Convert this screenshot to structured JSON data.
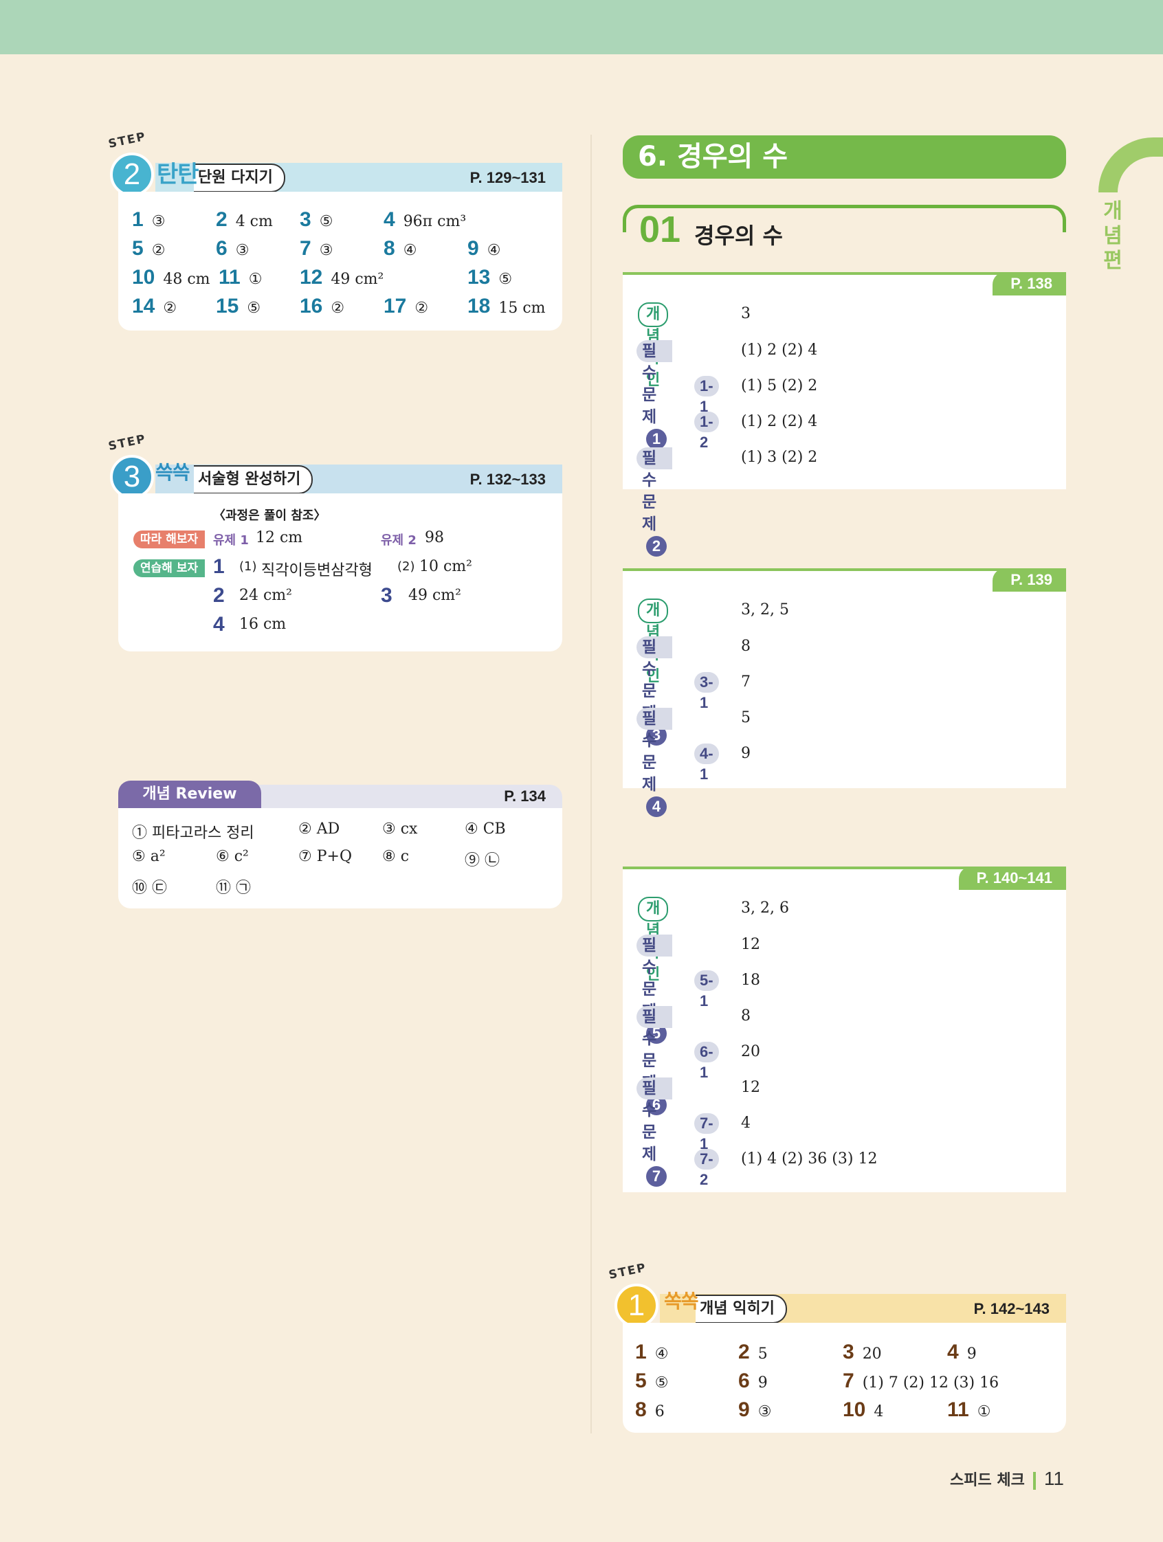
{
  "step2": {
    "step_label": "STEP",
    "step_num": "2",
    "title_big": "탄탄",
    "title": "단원 다지기",
    "pages": "P. 129~131",
    "answers": [
      {
        "n": "1",
        "v": "③"
      },
      {
        "n": "2",
        "v": "4 cm"
      },
      {
        "n": "3",
        "v": "⑤"
      },
      {
        "n": "4",
        "v": "96π cm³"
      },
      {
        "n": "5",
        "v": "②"
      },
      {
        "n": "6",
        "v": "③"
      },
      {
        "n": "7",
        "v": "③"
      },
      {
        "n": "8",
        "v": "④"
      },
      {
        "n": "9",
        "v": "④"
      },
      {
        "n": "10",
        "v": "48 cm"
      },
      {
        "n": "11",
        "v": "①"
      },
      {
        "n": "12",
        "v": "49 cm²"
      },
      {
        "n": "13",
        "v": "⑤"
      },
      {
        "n": "14",
        "v": "②"
      },
      {
        "n": "15",
        "v": "⑤"
      },
      {
        "n": "16",
        "v": "②"
      },
      {
        "n": "17",
        "v": "②"
      },
      {
        "n": "18",
        "v": "15 cm"
      }
    ]
  },
  "step3": {
    "step_label": "STEP",
    "step_num": "3",
    "title_big": "쓱쓱",
    "title": "서술형 완성하기",
    "pages": "P. 132~133",
    "note": "〈과정은 풀이 참조〉",
    "tag1": "따라 해보자",
    "tag2": "연습해 보자",
    "ex1_label": "유제 1",
    "ex1_value": "12 cm",
    "ex2_label": "유제 2",
    "ex2_value": "98",
    "p1_num": "1",
    "p1_a_label": "(1)",
    "p1_a": "직각이등변삼각형",
    "p1_b_label": "(2)",
    "p1_b": "10 cm²",
    "p2_num": "2",
    "p2": "24 cm²",
    "p3_num": "3",
    "p3": "49 cm²",
    "p4_num": "4",
    "p4": "16 cm"
  },
  "review": {
    "title": "개념 Review",
    "pages": "P. 134",
    "items": [
      "① 피타고라스 정리",
      "② AD",
      "③ cx",
      "④ CB",
      "⑤ a²",
      "⑥ c²",
      "⑦ P+Q",
      "⑧ c",
      "⑨ ㉡",
      "⑩ ㉢",
      "⑪ ㉠"
    ]
  },
  "chapter": {
    "title": "6. 경우의 수"
  },
  "section": {
    "num": "01",
    "title": "경우의 수"
  },
  "side": {
    "label": "개념편"
  },
  "labels": {
    "concept": "개념 확인",
    "required": "필수 문제"
  },
  "card1": {
    "pages": "P. 138",
    "concept": "3",
    "rows": [
      {
        "type": "pm",
        "c": "1",
        "v": "(1) 2   (2) 4"
      },
      {
        "type": "sub",
        "c": "1-1",
        "v": "(1) 5   (2) 2"
      },
      {
        "type": "sub",
        "c": "1-2",
        "v": "(1) 2   (2) 4"
      },
      {
        "type": "pm",
        "c": "2",
        "v": "(1) 3   (2) 2"
      }
    ]
  },
  "card2": {
    "pages": "P. 139",
    "concept": "3, 2, 5",
    "rows": [
      {
        "type": "pm",
        "c": "3",
        "v": "8"
      },
      {
        "type": "sub",
        "c": "3-1",
        "v": "7"
      },
      {
        "type": "pm",
        "c": "4",
        "v": "5"
      },
      {
        "type": "sub",
        "c": "4-1",
        "v": "9"
      }
    ]
  },
  "card3": {
    "pages": "P. 140~141",
    "concept": "3, 2, 6",
    "rows": [
      {
        "type": "pm",
        "c": "5",
        "v": "12"
      },
      {
        "type": "sub",
        "c": "5-1",
        "v": "18"
      },
      {
        "type": "pm",
        "c": "6",
        "v": "8"
      },
      {
        "type": "sub",
        "c": "6-1",
        "v": "20"
      },
      {
        "type": "pm",
        "c": "7",
        "v": "12"
      },
      {
        "type": "sub",
        "c": "7-1",
        "v": "4"
      },
      {
        "type": "sub",
        "c": "7-2",
        "v": "(1) 4   (2) 36   (3) 12"
      }
    ]
  },
  "step1": {
    "step_label": "STEP",
    "step_num": "1",
    "title_big": "쏙쏙",
    "title": "개념 익히기",
    "pages": "P. 142~143",
    "answers": [
      {
        "n": "1",
        "v": "④"
      },
      {
        "n": "2",
        "v": "5"
      },
      {
        "n": "3",
        "v": "20"
      },
      {
        "n": "4",
        "v": "9"
      },
      {
        "n": "5",
        "v": "⑤"
      },
      {
        "n": "6",
        "v": "9"
      },
      {
        "n": "7",
        "v": "(1) 7   (2) 12   (3) 16"
      },
      {
        "n": "8",
        "v": "6"
      },
      {
        "n": "9",
        "v": "③"
      },
      {
        "n": "10",
        "v": "4"
      },
      {
        "n": "11",
        "v": "①"
      }
    ]
  },
  "footer": {
    "text": "스피드 체크",
    "page": "11"
  },
  "colors": {
    "background": "#f8eedd",
    "top_band": "#acd6b8",
    "chapter_green": "#75b94a",
    "step2_circle": "#48b4d0",
    "step3_circle": "#3a9ec8",
    "step1_circle": "#f2c12e",
    "review_purple": "#7b6aa8",
    "label_purple": "#444a84"
  }
}
